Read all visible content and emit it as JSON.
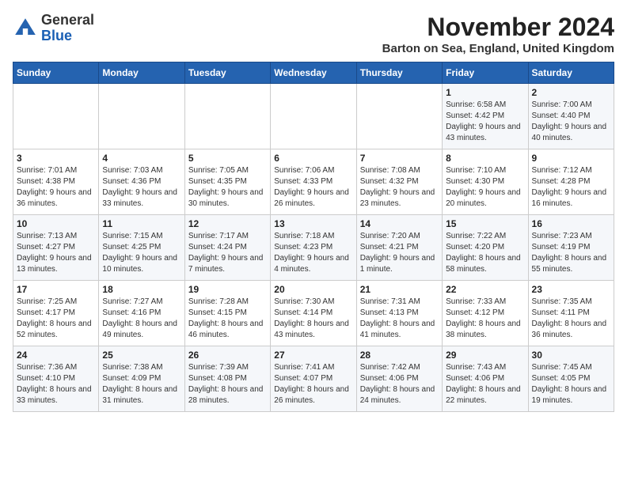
{
  "logo": {
    "general": "General",
    "blue": "Blue"
  },
  "title": "November 2024",
  "location": "Barton on Sea, England, United Kingdom",
  "days_header": [
    "Sunday",
    "Monday",
    "Tuesday",
    "Wednesday",
    "Thursday",
    "Friday",
    "Saturday"
  ],
  "weeks": [
    [
      {
        "day": "",
        "info": ""
      },
      {
        "day": "",
        "info": ""
      },
      {
        "day": "",
        "info": ""
      },
      {
        "day": "",
        "info": ""
      },
      {
        "day": "",
        "info": ""
      },
      {
        "day": "1",
        "info": "Sunrise: 6:58 AM\nSunset: 4:42 PM\nDaylight: 9 hours and 43 minutes."
      },
      {
        "day": "2",
        "info": "Sunrise: 7:00 AM\nSunset: 4:40 PM\nDaylight: 9 hours and 40 minutes."
      }
    ],
    [
      {
        "day": "3",
        "info": "Sunrise: 7:01 AM\nSunset: 4:38 PM\nDaylight: 9 hours and 36 minutes."
      },
      {
        "day": "4",
        "info": "Sunrise: 7:03 AM\nSunset: 4:36 PM\nDaylight: 9 hours and 33 minutes."
      },
      {
        "day": "5",
        "info": "Sunrise: 7:05 AM\nSunset: 4:35 PM\nDaylight: 9 hours and 30 minutes."
      },
      {
        "day": "6",
        "info": "Sunrise: 7:06 AM\nSunset: 4:33 PM\nDaylight: 9 hours and 26 minutes."
      },
      {
        "day": "7",
        "info": "Sunrise: 7:08 AM\nSunset: 4:32 PM\nDaylight: 9 hours and 23 minutes."
      },
      {
        "day": "8",
        "info": "Sunrise: 7:10 AM\nSunset: 4:30 PM\nDaylight: 9 hours and 20 minutes."
      },
      {
        "day": "9",
        "info": "Sunrise: 7:12 AM\nSunset: 4:28 PM\nDaylight: 9 hours and 16 minutes."
      }
    ],
    [
      {
        "day": "10",
        "info": "Sunrise: 7:13 AM\nSunset: 4:27 PM\nDaylight: 9 hours and 13 minutes."
      },
      {
        "day": "11",
        "info": "Sunrise: 7:15 AM\nSunset: 4:25 PM\nDaylight: 9 hours and 10 minutes."
      },
      {
        "day": "12",
        "info": "Sunrise: 7:17 AM\nSunset: 4:24 PM\nDaylight: 9 hours and 7 minutes."
      },
      {
        "day": "13",
        "info": "Sunrise: 7:18 AM\nSunset: 4:23 PM\nDaylight: 9 hours and 4 minutes."
      },
      {
        "day": "14",
        "info": "Sunrise: 7:20 AM\nSunset: 4:21 PM\nDaylight: 9 hours and 1 minute."
      },
      {
        "day": "15",
        "info": "Sunrise: 7:22 AM\nSunset: 4:20 PM\nDaylight: 8 hours and 58 minutes."
      },
      {
        "day": "16",
        "info": "Sunrise: 7:23 AM\nSunset: 4:19 PM\nDaylight: 8 hours and 55 minutes."
      }
    ],
    [
      {
        "day": "17",
        "info": "Sunrise: 7:25 AM\nSunset: 4:17 PM\nDaylight: 8 hours and 52 minutes."
      },
      {
        "day": "18",
        "info": "Sunrise: 7:27 AM\nSunset: 4:16 PM\nDaylight: 8 hours and 49 minutes."
      },
      {
        "day": "19",
        "info": "Sunrise: 7:28 AM\nSunset: 4:15 PM\nDaylight: 8 hours and 46 minutes."
      },
      {
        "day": "20",
        "info": "Sunrise: 7:30 AM\nSunset: 4:14 PM\nDaylight: 8 hours and 43 minutes."
      },
      {
        "day": "21",
        "info": "Sunrise: 7:31 AM\nSunset: 4:13 PM\nDaylight: 8 hours and 41 minutes."
      },
      {
        "day": "22",
        "info": "Sunrise: 7:33 AM\nSunset: 4:12 PM\nDaylight: 8 hours and 38 minutes."
      },
      {
        "day": "23",
        "info": "Sunrise: 7:35 AM\nSunset: 4:11 PM\nDaylight: 8 hours and 36 minutes."
      }
    ],
    [
      {
        "day": "24",
        "info": "Sunrise: 7:36 AM\nSunset: 4:10 PM\nDaylight: 8 hours and 33 minutes."
      },
      {
        "day": "25",
        "info": "Sunrise: 7:38 AM\nSunset: 4:09 PM\nDaylight: 8 hours and 31 minutes."
      },
      {
        "day": "26",
        "info": "Sunrise: 7:39 AM\nSunset: 4:08 PM\nDaylight: 8 hours and 28 minutes."
      },
      {
        "day": "27",
        "info": "Sunrise: 7:41 AM\nSunset: 4:07 PM\nDaylight: 8 hours and 26 minutes."
      },
      {
        "day": "28",
        "info": "Sunrise: 7:42 AM\nSunset: 4:06 PM\nDaylight: 8 hours and 24 minutes."
      },
      {
        "day": "29",
        "info": "Sunrise: 7:43 AM\nSunset: 4:06 PM\nDaylight: 8 hours and 22 minutes."
      },
      {
        "day": "30",
        "info": "Sunrise: 7:45 AM\nSunset: 4:05 PM\nDaylight: 8 hours and 19 minutes."
      }
    ]
  ]
}
